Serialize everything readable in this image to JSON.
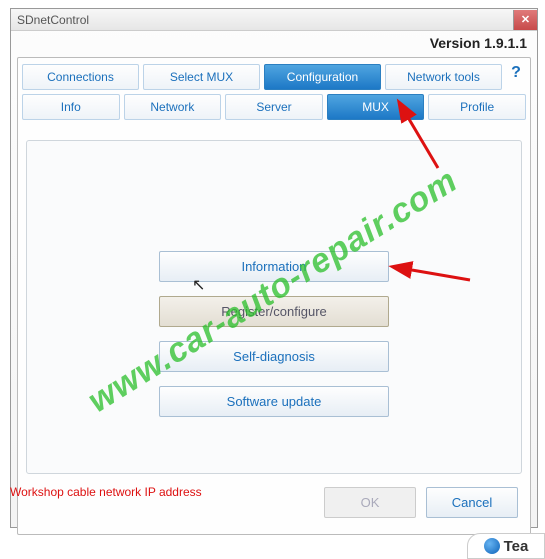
{
  "window": {
    "title": "SDnetControl",
    "version": "Version 1.9.1.1"
  },
  "tabs_primary": {
    "items": [
      {
        "label": "Connections"
      },
      {
        "label": "Select MUX"
      },
      {
        "label": "Configuration"
      },
      {
        "label": "Network tools"
      }
    ],
    "active_index": 2,
    "help": "?"
  },
  "tabs_secondary": {
    "items": [
      {
        "label": "Info"
      },
      {
        "label": "Network"
      },
      {
        "label": "Server"
      },
      {
        "label": "MUX"
      },
      {
        "label": "Profile"
      }
    ],
    "active_index": 3
  },
  "mux_buttons": {
    "information": "Information",
    "register_configure": "Register/configure",
    "self_diagnosis": "Self-diagnosis",
    "software_update": "Software update"
  },
  "status": {
    "text": "Workshop cable network IP address"
  },
  "dialog": {
    "ok": "OK",
    "cancel": "Cancel"
  },
  "overlay": {
    "teamviewer": "Tea",
    "watermark": "www.car-auto-repair.com"
  }
}
